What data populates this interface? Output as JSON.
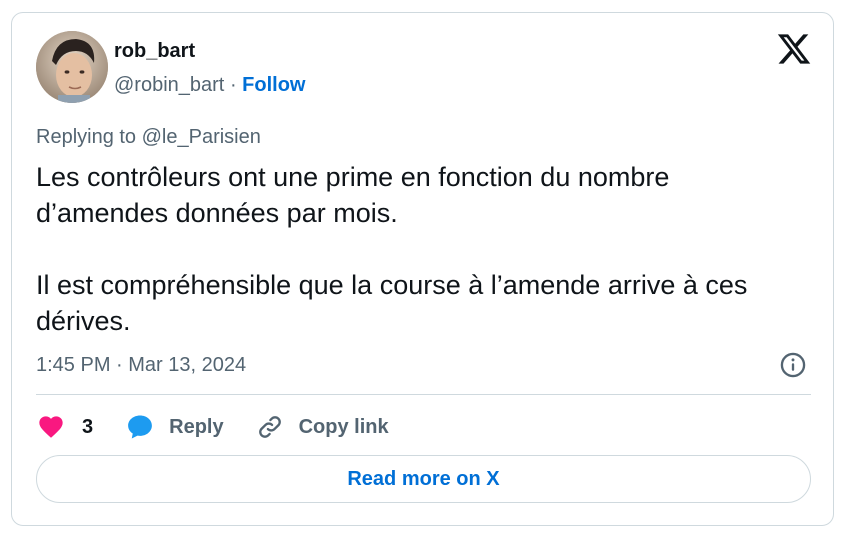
{
  "author": {
    "display_name": "rob_bart",
    "handle": "@robin_bart",
    "separator": "·",
    "follow_label": "Follow"
  },
  "reply_context": {
    "prefix": "Replying to ",
    "mention": "@le_Parisien"
  },
  "tweet": {
    "paragraphs": [
      "Les contrôleurs ont une prime en fonction du nombre d’amendes données par mois.",
      "Il est compréhensible que la course à l’amende arrive à ces dérives."
    ],
    "timestamp": "1:45 PM · Mar 13, 2024"
  },
  "actions": {
    "like_count": "3",
    "reply_label": "Reply",
    "copy_link_label": "Copy link"
  },
  "footer": {
    "read_more_label": "Read more on X"
  },
  "icons": {
    "logo": "x-logo-icon",
    "info": "info-icon",
    "like": "heart-icon",
    "reply": "speech-bubble-icon",
    "copy": "link-icon"
  },
  "colors": {
    "accent": "#006fd6",
    "heart": "#f91880",
    "reply_bubble": "#1d9bf0",
    "text_primary": "#0f1419",
    "text_secondary": "#536471",
    "border": "#cfd9de"
  }
}
